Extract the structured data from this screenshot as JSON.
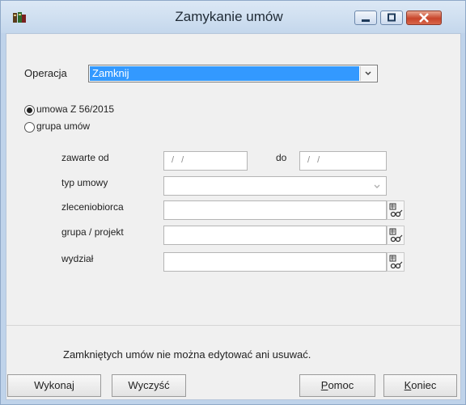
{
  "window": {
    "title": "Zamykanie umów"
  },
  "operation": {
    "label": "Operacja",
    "value": "Zamknij"
  },
  "scope": {
    "option_single": "umowa Z 56/2015",
    "option_group": "grupa umów",
    "selected": "option_single"
  },
  "filters": {
    "from_label": "zawarte od",
    "from_value": "/ /",
    "to_label": "do",
    "to_value": "/ /",
    "type_label": "typ umowy",
    "type_value": "",
    "contractor_label": "zleceniobiorca",
    "contractor_value": "",
    "project_label": "grupa / projekt",
    "project_value": "",
    "department_label": "wydział",
    "department_value": ""
  },
  "status_note": "Zamkniętych umów nie można edytować ani usuwać.",
  "buttons": {
    "execute": "Wykonaj",
    "clear": "Wyczyść",
    "help_first": "P",
    "help_rest": "omoc",
    "close_first": "K",
    "close_rest": "oniec"
  },
  "colors": {
    "selection": "#3399ff",
    "title_bar": "#c4d7ec",
    "close_button": "#c8442a"
  }
}
